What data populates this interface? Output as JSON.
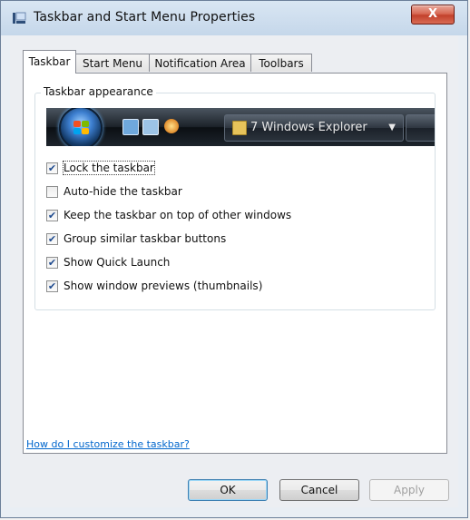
{
  "window": {
    "title": "Taskbar and Start Menu Properties",
    "close_label": "X"
  },
  "tabs": [
    {
      "label": "Taskbar",
      "active": true
    },
    {
      "label": "Start Menu",
      "active": false
    },
    {
      "label": "Notification Area",
      "active": false
    },
    {
      "label": "Toolbars",
      "active": false
    }
  ],
  "group": {
    "label": "Taskbar appearance",
    "preview": {
      "task_label": "7 Windows Explorer",
      "task_arrow": "▼"
    }
  },
  "options": [
    {
      "label": "Lock the taskbar",
      "checked": true
    },
    {
      "label": "Auto-hide the taskbar",
      "checked": false
    },
    {
      "label": "Keep the taskbar on top of other windows",
      "checked": true
    },
    {
      "label": "Group similar taskbar buttons",
      "checked": true
    },
    {
      "label": "Show Quick Launch",
      "checked": true
    },
    {
      "label": "Show window previews (thumbnails)",
      "checked": true
    }
  ],
  "help_link": "How do I customize the taskbar?",
  "buttons": {
    "ok": "OK",
    "cancel": "Cancel",
    "apply": "Apply"
  }
}
